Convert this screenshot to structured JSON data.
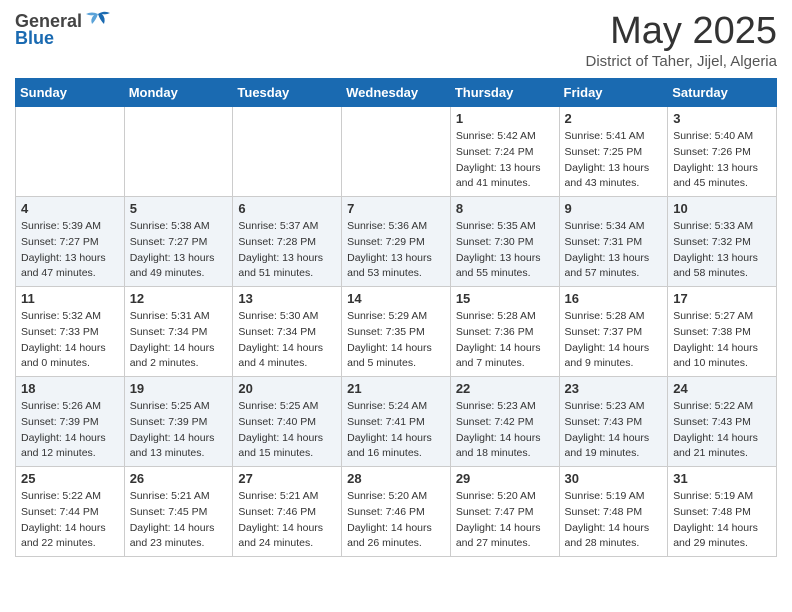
{
  "logo": {
    "general": "General",
    "blue": "Blue"
  },
  "title": "May 2025",
  "subtitle": "District of Taher, Jijel, Algeria",
  "weekdays": [
    "Sunday",
    "Monday",
    "Tuesday",
    "Wednesday",
    "Thursday",
    "Friday",
    "Saturday"
  ],
  "weeks": [
    [
      {
        "day": "",
        "info": ""
      },
      {
        "day": "",
        "info": ""
      },
      {
        "day": "",
        "info": ""
      },
      {
        "day": "",
        "info": ""
      },
      {
        "day": "1",
        "sunrise": "Sunrise: 5:42 AM",
        "sunset": "Sunset: 7:24 PM",
        "daylight": "Daylight: 13 hours and 41 minutes."
      },
      {
        "day": "2",
        "sunrise": "Sunrise: 5:41 AM",
        "sunset": "Sunset: 7:25 PM",
        "daylight": "Daylight: 13 hours and 43 minutes."
      },
      {
        "day": "3",
        "sunrise": "Sunrise: 5:40 AM",
        "sunset": "Sunset: 7:26 PM",
        "daylight": "Daylight: 13 hours and 45 minutes."
      }
    ],
    [
      {
        "day": "4",
        "sunrise": "Sunrise: 5:39 AM",
        "sunset": "Sunset: 7:27 PM",
        "daylight": "Daylight: 13 hours and 47 minutes."
      },
      {
        "day": "5",
        "sunrise": "Sunrise: 5:38 AM",
        "sunset": "Sunset: 7:27 PM",
        "daylight": "Daylight: 13 hours and 49 minutes."
      },
      {
        "day": "6",
        "sunrise": "Sunrise: 5:37 AM",
        "sunset": "Sunset: 7:28 PM",
        "daylight": "Daylight: 13 hours and 51 minutes."
      },
      {
        "day": "7",
        "sunrise": "Sunrise: 5:36 AM",
        "sunset": "Sunset: 7:29 PM",
        "daylight": "Daylight: 13 hours and 53 minutes."
      },
      {
        "day": "8",
        "sunrise": "Sunrise: 5:35 AM",
        "sunset": "Sunset: 7:30 PM",
        "daylight": "Daylight: 13 hours and 55 minutes."
      },
      {
        "day": "9",
        "sunrise": "Sunrise: 5:34 AM",
        "sunset": "Sunset: 7:31 PM",
        "daylight": "Daylight: 13 hours and 57 minutes."
      },
      {
        "day": "10",
        "sunrise": "Sunrise: 5:33 AM",
        "sunset": "Sunset: 7:32 PM",
        "daylight": "Daylight: 13 hours and 58 minutes."
      }
    ],
    [
      {
        "day": "11",
        "sunrise": "Sunrise: 5:32 AM",
        "sunset": "Sunset: 7:33 PM",
        "daylight": "Daylight: 14 hours and 0 minutes."
      },
      {
        "day": "12",
        "sunrise": "Sunrise: 5:31 AM",
        "sunset": "Sunset: 7:34 PM",
        "daylight": "Daylight: 14 hours and 2 minutes."
      },
      {
        "day": "13",
        "sunrise": "Sunrise: 5:30 AM",
        "sunset": "Sunset: 7:34 PM",
        "daylight": "Daylight: 14 hours and 4 minutes."
      },
      {
        "day": "14",
        "sunrise": "Sunrise: 5:29 AM",
        "sunset": "Sunset: 7:35 PM",
        "daylight": "Daylight: 14 hours and 5 minutes."
      },
      {
        "day": "15",
        "sunrise": "Sunrise: 5:28 AM",
        "sunset": "Sunset: 7:36 PM",
        "daylight": "Daylight: 14 hours and 7 minutes."
      },
      {
        "day": "16",
        "sunrise": "Sunrise: 5:28 AM",
        "sunset": "Sunset: 7:37 PM",
        "daylight": "Daylight: 14 hours and 9 minutes."
      },
      {
        "day": "17",
        "sunrise": "Sunrise: 5:27 AM",
        "sunset": "Sunset: 7:38 PM",
        "daylight": "Daylight: 14 hours and 10 minutes."
      }
    ],
    [
      {
        "day": "18",
        "sunrise": "Sunrise: 5:26 AM",
        "sunset": "Sunset: 7:39 PM",
        "daylight": "Daylight: 14 hours and 12 minutes."
      },
      {
        "day": "19",
        "sunrise": "Sunrise: 5:25 AM",
        "sunset": "Sunset: 7:39 PM",
        "daylight": "Daylight: 14 hours and 13 minutes."
      },
      {
        "day": "20",
        "sunrise": "Sunrise: 5:25 AM",
        "sunset": "Sunset: 7:40 PM",
        "daylight": "Daylight: 14 hours and 15 minutes."
      },
      {
        "day": "21",
        "sunrise": "Sunrise: 5:24 AM",
        "sunset": "Sunset: 7:41 PM",
        "daylight": "Daylight: 14 hours and 16 minutes."
      },
      {
        "day": "22",
        "sunrise": "Sunrise: 5:23 AM",
        "sunset": "Sunset: 7:42 PM",
        "daylight": "Daylight: 14 hours and 18 minutes."
      },
      {
        "day": "23",
        "sunrise": "Sunrise: 5:23 AM",
        "sunset": "Sunset: 7:43 PM",
        "daylight": "Daylight: 14 hours and 19 minutes."
      },
      {
        "day": "24",
        "sunrise": "Sunrise: 5:22 AM",
        "sunset": "Sunset: 7:43 PM",
        "daylight": "Daylight: 14 hours and 21 minutes."
      }
    ],
    [
      {
        "day": "25",
        "sunrise": "Sunrise: 5:22 AM",
        "sunset": "Sunset: 7:44 PM",
        "daylight": "Daylight: 14 hours and 22 minutes."
      },
      {
        "day": "26",
        "sunrise": "Sunrise: 5:21 AM",
        "sunset": "Sunset: 7:45 PM",
        "daylight": "Daylight: 14 hours and 23 minutes."
      },
      {
        "day": "27",
        "sunrise": "Sunrise: 5:21 AM",
        "sunset": "Sunset: 7:46 PM",
        "daylight": "Daylight: 14 hours and 24 minutes."
      },
      {
        "day": "28",
        "sunrise": "Sunrise: 5:20 AM",
        "sunset": "Sunset: 7:46 PM",
        "daylight": "Daylight: 14 hours and 26 minutes."
      },
      {
        "day": "29",
        "sunrise": "Sunrise: 5:20 AM",
        "sunset": "Sunset: 7:47 PM",
        "daylight": "Daylight: 14 hours and 27 minutes."
      },
      {
        "day": "30",
        "sunrise": "Sunrise: 5:19 AM",
        "sunset": "Sunset: 7:48 PM",
        "daylight": "Daylight: 14 hours and 28 minutes."
      },
      {
        "day": "31",
        "sunrise": "Sunrise: 5:19 AM",
        "sunset": "Sunset: 7:48 PM",
        "daylight": "Daylight: 14 hours and 29 minutes."
      }
    ]
  ]
}
